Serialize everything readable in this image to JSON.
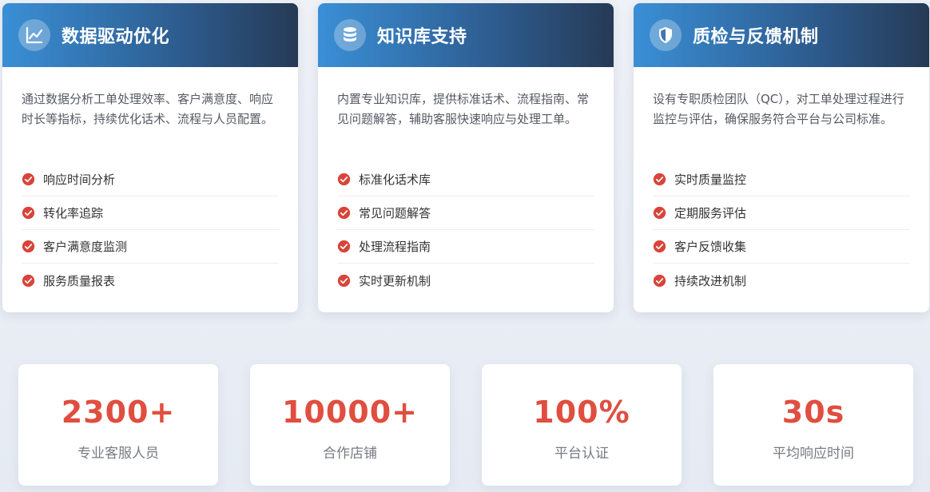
{
  "cards": [
    {
      "icon": "chart-line-icon",
      "title": "数据驱动优化",
      "description": "通过数据分析工单处理效率、客户满意度、响应时长等指标，持续优化话术、流程与人员配置。",
      "features": [
        "响应时间分析",
        "转化率追踪",
        "客户满意度监测",
        "服务质量报表"
      ]
    },
    {
      "icon": "database-icon",
      "title": "知识库支持",
      "description": "内置专业知识库，提供标准话术、流程指南、常见问题解答，辅助客服快速响应与处理工单。",
      "features": [
        "标准化话术库",
        "常见问题解答",
        "处理流程指南",
        "实时更新机制"
      ]
    },
    {
      "icon": "shield-check-icon",
      "title": "质检与反馈机制",
      "description": "设有专职质检团队（QC），对工单处理过程进行监控与评估，确保服务符合平台与公司标准。",
      "features": [
        "实时质量监控",
        "定期服务评估",
        "客户反馈收集",
        "持续改进机制"
      ]
    }
  ],
  "stats": [
    {
      "value": "2300+",
      "label": "专业客服人员"
    },
    {
      "value": "10000+",
      "label": "合作店铺"
    },
    {
      "value": "100%",
      "label": "平台认证"
    },
    {
      "value": "30s",
      "label": "平均响应时间"
    }
  ],
  "colors": {
    "accent": "#e04e3f",
    "header_start": "#3a8fd6",
    "header_end": "#263a55",
    "check": "#d9443a"
  }
}
